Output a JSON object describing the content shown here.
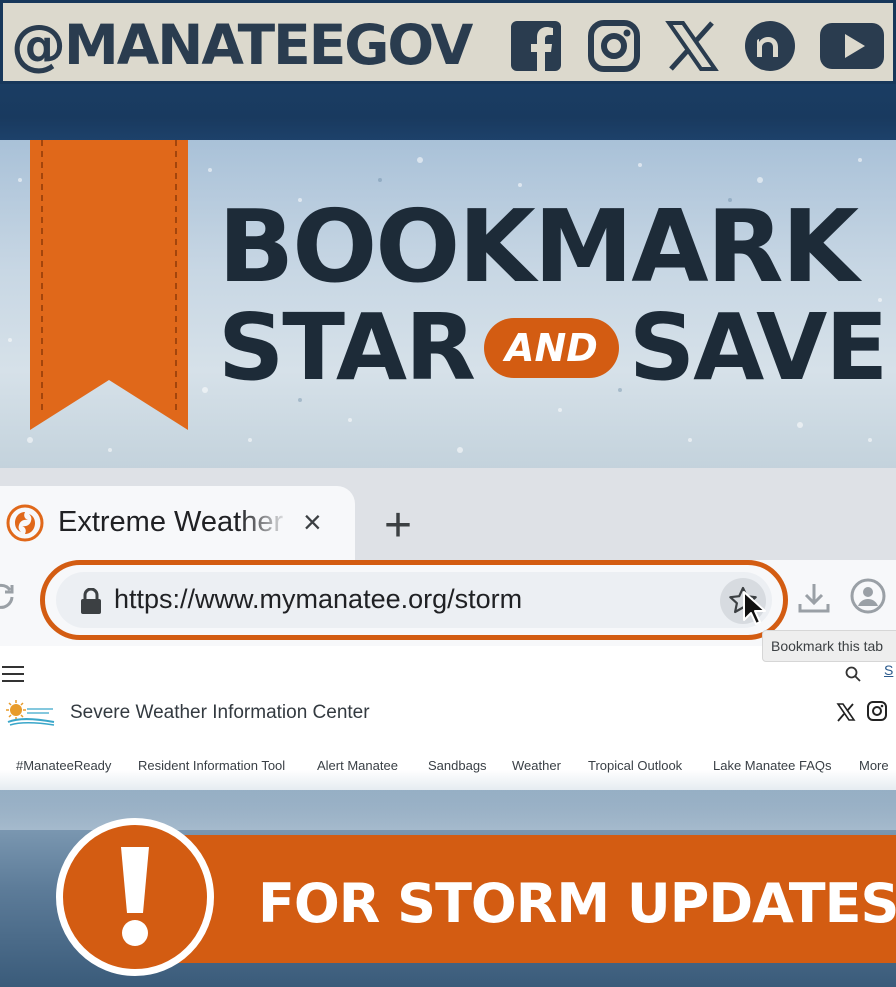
{
  "social_bar": {
    "handle": "@MANATEEGOV",
    "icons": [
      "facebook-icon",
      "instagram-icon",
      "x-icon",
      "nextdoor-icon",
      "youtube-icon"
    ]
  },
  "hero": {
    "line1": "BOOKMARK",
    "line2_left": "STAR",
    "line2_pill": "AND",
    "line2_right": "SAVE"
  },
  "browser": {
    "tab_title": "Extreme Weather",
    "tab_close": "×",
    "new_tab": "+",
    "url": "https://www.mymanatee.org/storm",
    "tooltip": "Bookmark this tab"
  },
  "site": {
    "title": "Severe Weather Information Center",
    "search_link": "S",
    "nav": [
      "#ManateeReady",
      "Resident Information Tool",
      "Alert Manatee",
      "Sandbags",
      "Weather",
      "Tropical Outlook",
      "Lake Manatee FAQs",
      "More"
    ]
  },
  "banner": {
    "text": "FOR STORM UPDATES"
  },
  "colors": {
    "accent_orange": "#d35c12",
    "navy": "#1d2b38",
    "brand_blue": "#17375a"
  }
}
